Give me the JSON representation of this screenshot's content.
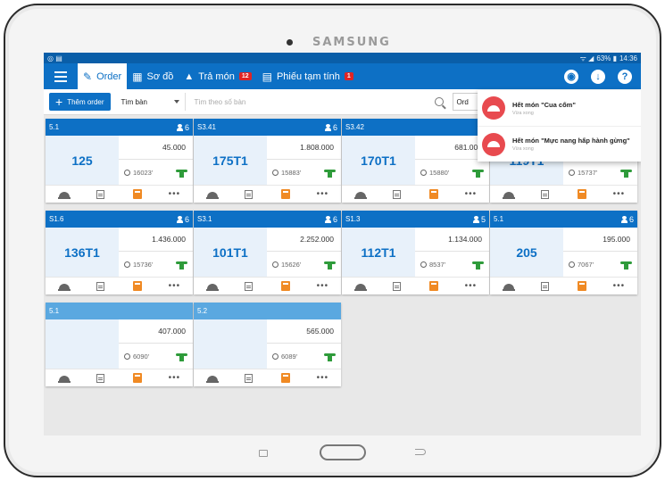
{
  "device": {
    "brand": "SAMSUNG"
  },
  "statusbar": {
    "left_icons": "◎ ▤",
    "signal": "ᯤ ◢",
    "battery": "63% ▮",
    "time": "14:36"
  },
  "nav": {
    "tabs": [
      {
        "label": "Order",
        "icon": "edit-icon",
        "active": true
      },
      {
        "label": "Sơ đồ",
        "icon": "map-icon"
      },
      {
        "label": "Trả món",
        "icon": "cloche-icon",
        "badge": "12"
      },
      {
        "label": "Phiếu tạm tính",
        "icon": "receipt-icon",
        "badge": "1"
      }
    ],
    "action_icons": [
      "globe-icon",
      "cloud-download-icon",
      "help-icon"
    ]
  },
  "toolbar": {
    "add_label": "Thêm order",
    "filter_value": "Tìm bàn",
    "search_placeholder": "Tìm theo số bàn",
    "order_label": "Ord"
  },
  "tables": [
    {
      "name": "5.1",
      "guests": "6",
      "code": "125",
      "amount": "45.000",
      "time": "16023'"
    },
    {
      "name": "S3.41",
      "guests": "6",
      "code": "175T1",
      "amount": "1.808.000",
      "time": "15883'"
    },
    {
      "name": "S3.42",
      "guests": "",
      "code": "170T1",
      "amount": "681.000",
      "time": "15880'"
    },
    {
      "name": "",
      "guests": "",
      "code": "119T1",
      "amount": "",
      "time": "15737'"
    },
    {
      "name": "S1.6",
      "guests": "6",
      "code": "136T1",
      "amount": "1.436.000",
      "time": "15736'"
    },
    {
      "name": "S3.1",
      "guests": "6",
      "code": "101T1",
      "amount": "2.252.000",
      "time": "15626'"
    },
    {
      "name": "S1.3",
      "guests": "5",
      "code": "112T1",
      "amount": "1.134.000",
      "time": "8537'"
    },
    {
      "name": "5.1",
      "guests": "6",
      "code": "205",
      "amount": "195.000",
      "time": "7067'"
    },
    {
      "name": "5.1",
      "guests": "",
      "code": "",
      "amount": "407.000",
      "time": "6090'",
      "light": true
    },
    {
      "name": "5.2",
      "guests": "",
      "code": "",
      "amount": "565.000",
      "time": "6089'",
      "light": true
    }
  ],
  "notifications": [
    {
      "title": "Hết món \"Cua cốm\"",
      "sub": "Vừa xong"
    },
    {
      "title": "Hết món \"Mực nang hấp hành gừng\"",
      "sub": "Vừa xong"
    }
  ],
  "colors": {
    "primary": "#0d70c5",
    "light_header": "#5aa8e0",
    "code_bg": "#e8f1fa",
    "badge": "#e02424",
    "notif_icon": "#e84a4f",
    "calc": "#f08a24",
    "waiter": "#2e9b3a"
  }
}
